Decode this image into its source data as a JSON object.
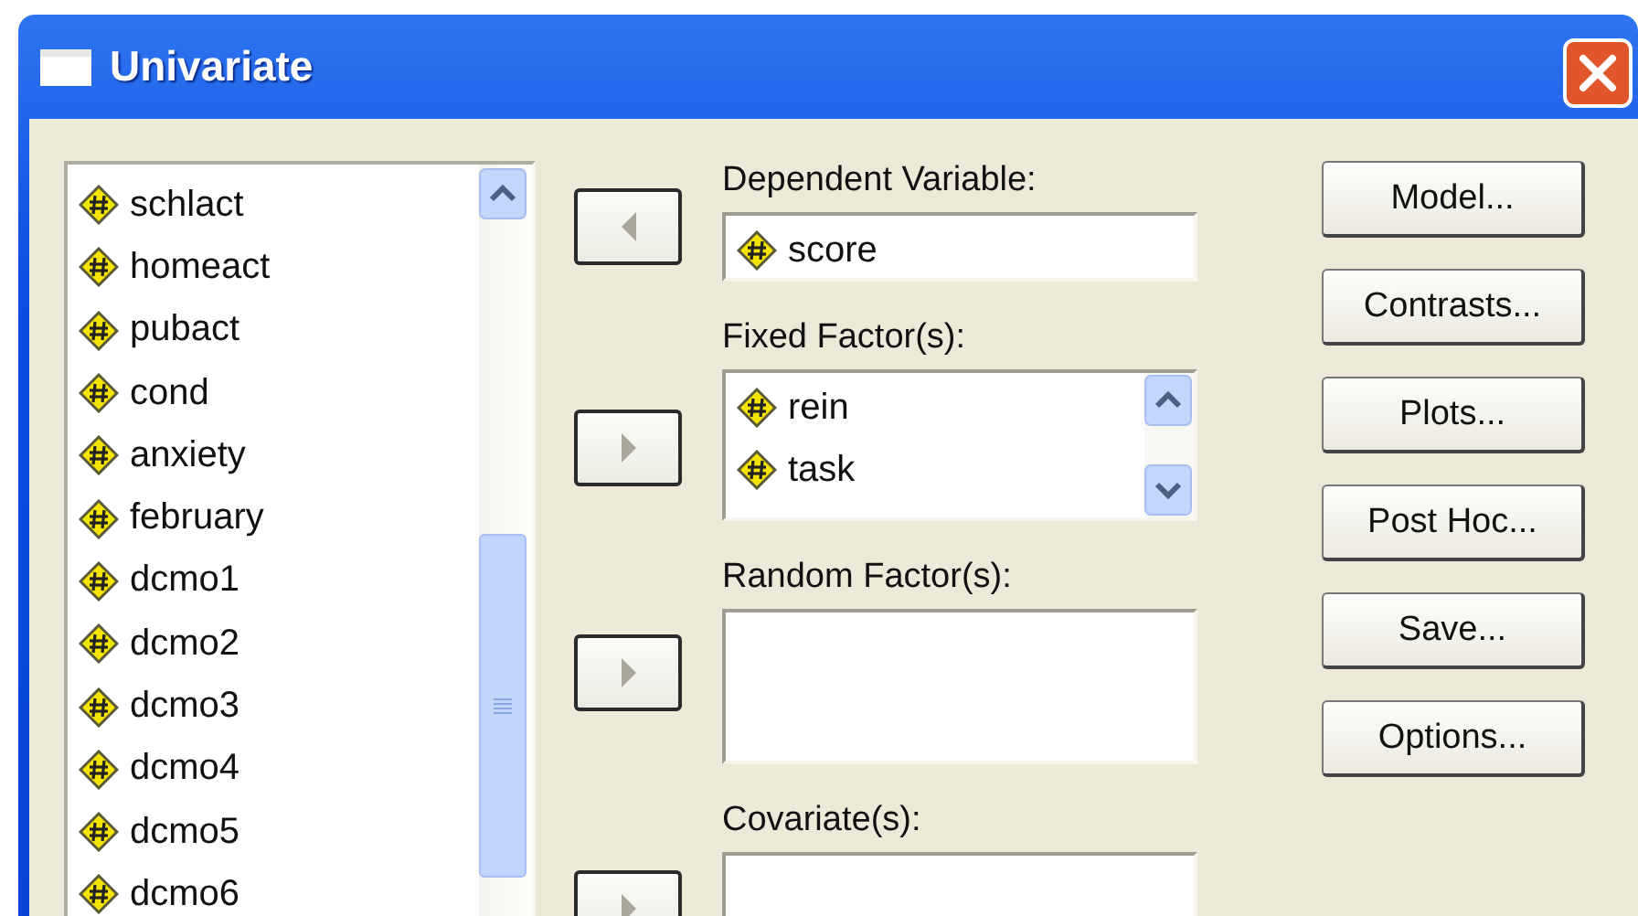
{
  "window": {
    "title": "Univariate"
  },
  "variables": [
    "schlact",
    "homeact",
    "pubact",
    "cond",
    "anxiety",
    "february",
    "dcmo1",
    "dcmo2",
    "dcmo3",
    "dcmo4",
    "dcmo5",
    "dcmo6"
  ],
  "targets": [
    {
      "kind": "field",
      "arrow": {
        "kind": "left"
      },
      "label": "Dependent Variable:",
      "items": [
        "score"
      ]
    },
    {
      "kind": "list",
      "arrow": {
        "kind": "right"
      },
      "label": "Fixed Factor(s):",
      "items": [
        "rein",
        "task"
      ]
    },
    {
      "kind": "box",
      "arrow": {
        "kind": "right"
      },
      "label": "Random Factor(s):"
    },
    {
      "kind": "box",
      "arrow": {
        "kind": "right"
      },
      "label": "Covariate(s):"
    }
  ],
  "buttons": [
    {
      "label": "Model..."
    },
    {
      "label": "Contrasts..."
    },
    {
      "label": "Plots..."
    },
    {
      "label": "Post Hoc..."
    },
    {
      "label": "Save..."
    },
    {
      "label": "Options..."
    }
  ]
}
